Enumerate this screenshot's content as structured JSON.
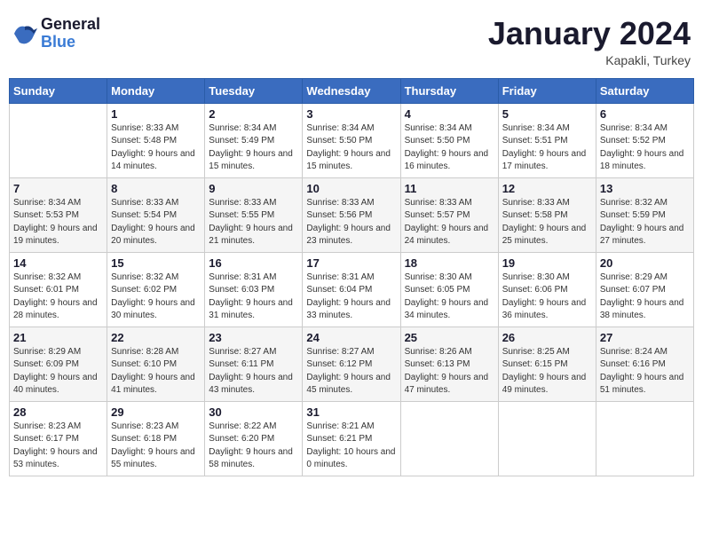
{
  "header": {
    "logo_line1": "General",
    "logo_line2": "Blue",
    "month": "January 2024",
    "location": "Kapakli, Turkey"
  },
  "weekdays": [
    "Sunday",
    "Monday",
    "Tuesday",
    "Wednesday",
    "Thursday",
    "Friday",
    "Saturday"
  ],
  "weeks": [
    [
      {
        "day": "",
        "sunrise": "",
        "sunset": "",
        "daylight": ""
      },
      {
        "day": "1",
        "sunrise": "Sunrise: 8:33 AM",
        "sunset": "Sunset: 5:48 PM",
        "daylight": "Daylight: 9 hours and 14 minutes."
      },
      {
        "day": "2",
        "sunrise": "Sunrise: 8:34 AM",
        "sunset": "Sunset: 5:49 PM",
        "daylight": "Daylight: 9 hours and 15 minutes."
      },
      {
        "day": "3",
        "sunrise": "Sunrise: 8:34 AM",
        "sunset": "Sunset: 5:50 PM",
        "daylight": "Daylight: 9 hours and 15 minutes."
      },
      {
        "day": "4",
        "sunrise": "Sunrise: 8:34 AM",
        "sunset": "Sunset: 5:50 PM",
        "daylight": "Daylight: 9 hours and 16 minutes."
      },
      {
        "day": "5",
        "sunrise": "Sunrise: 8:34 AM",
        "sunset": "Sunset: 5:51 PM",
        "daylight": "Daylight: 9 hours and 17 minutes."
      },
      {
        "day": "6",
        "sunrise": "Sunrise: 8:34 AM",
        "sunset": "Sunset: 5:52 PM",
        "daylight": "Daylight: 9 hours and 18 minutes."
      }
    ],
    [
      {
        "day": "7",
        "sunrise": "Sunrise: 8:34 AM",
        "sunset": "Sunset: 5:53 PM",
        "daylight": "Daylight: 9 hours and 19 minutes."
      },
      {
        "day": "8",
        "sunrise": "Sunrise: 8:33 AM",
        "sunset": "Sunset: 5:54 PM",
        "daylight": "Daylight: 9 hours and 20 minutes."
      },
      {
        "day": "9",
        "sunrise": "Sunrise: 8:33 AM",
        "sunset": "Sunset: 5:55 PM",
        "daylight": "Daylight: 9 hours and 21 minutes."
      },
      {
        "day": "10",
        "sunrise": "Sunrise: 8:33 AM",
        "sunset": "Sunset: 5:56 PM",
        "daylight": "Daylight: 9 hours and 23 minutes."
      },
      {
        "day": "11",
        "sunrise": "Sunrise: 8:33 AM",
        "sunset": "Sunset: 5:57 PM",
        "daylight": "Daylight: 9 hours and 24 minutes."
      },
      {
        "day": "12",
        "sunrise": "Sunrise: 8:33 AM",
        "sunset": "Sunset: 5:58 PM",
        "daylight": "Daylight: 9 hours and 25 minutes."
      },
      {
        "day": "13",
        "sunrise": "Sunrise: 8:32 AM",
        "sunset": "Sunset: 5:59 PM",
        "daylight": "Daylight: 9 hours and 27 minutes."
      }
    ],
    [
      {
        "day": "14",
        "sunrise": "Sunrise: 8:32 AM",
        "sunset": "Sunset: 6:01 PM",
        "daylight": "Daylight: 9 hours and 28 minutes."
      },
      {
        "day": "15",
        "sunrise": "Sunrise: 8:32 AM",
        "sunset": "Sunset: 6:02 PM",
        "daylight": "Daylight: 9 hours and 30 minutes."
      },
      {
        "day": "16",
        "sunrise": "Sunrise: 8:31 AM",
        "sunset": "Sunset: 6:03 PM",
        "daylight": "Daylight: 9 hours and 31 minutes."
      },
      {
        "day": "17",
        "sunrise": "Sunrise: 8:31 AM",
        "sunset": "Sunset: 6:04 PM",
        "daylight": "Daylight: 9 hours and 33 minutes."
      },
      {
        "day": "18",
        "sunrise": "Sunrise: 8:30 AM",
        "sunset": "Sunset: 6:05 PM",
        "daylight": "Daylight: 9 hours and 34 minutes."
      },
      {
        "day": "19",
        "sunrise": "Sunrise: 8:30 AM",
        "sunset": "Sunset: 6:06 PM",
        "daylight": "Daylight: 9 hours and 36 minutes."
      },
      {
        "day": "20",
        "sunrise": "Sunrise: 8:29 AM",
        "sunset": "Sunset: 6:07 PM",
        "daylight": "Daylight: 9 hours and 38 minutes."
      }
    ],
    [
      {
        "day": "21",
        "sunrise": "Sunrise: 8:29 AM",
        "sunset": "Sunset: 6:09 PM",
        "daylight": "Daylight: 9 hours and 40 minutes."
      },
      {
        "day": "22",
        "sunrise": "Sunrise: 8:28 AM",
        "sunset": "Sunset: 6:10 PM",
        "daylight": "Daylight: 9 hours and 41 minutes."
      },
      {
        "day": "23",
        "sunrise": "Sunrise: 8:27 AM",
        "sunset": "Sunset: 6:11 PM",
        "daylight": "Daylight: 9 hours and 43 minutes."
      },
      {
        "day": "24",
        "sunrise": "Sunrise: 8:27 AM",
        "sunset": "Sunset: 6:12 PM",
        "daylight": "Daylight: 9 hours and 45 minutes."
      },
      {
        "day": "25",
        "sunrise": "Sunrise: 8:26 AM",
        "sunset": "Sunset: 6:13 PM",
        "daylight": "Daylight: 9 hours and 47 minutes."
      },
      {
        "day": "26",
        "sunrise": "Sunrise: 8:25 AM",
        "sunset": "Sunset: 6:15 PM",
        "daylight": "Daylight: 9 hours and 49 minutes."
      },
      {
        "day": "27",
        "sunrise": "Sunrise: 8:24 AM",
        "sunset": "Sunset: 6:16 PM",
        "daylight": "Daylight: 9 hours and 51 minutes."
      }
    ],
    [
      {
        "day": "28",
        "sunrise": "Sunrise: 8:23 AM",
        "sunset": "Sunset: 6:17 PM",
        "daylight": "Daylight: 9 hours and 53 minutes."
      },
      {
        "day": "29",
        "sunrise": "Sunrise: 8:23 AM",
        "sunset": "Sunset: 6:18 PM",
        "daylight": "Daylight: 9 hours and 55 minutes."
      },
      {
        "day": "30",
        "sunrise": "Sunrise: 8:22 AM",
        "sunset": "Sunset: 6:20 PM",
        "daylight": "Daylight: 9 hours and 58 minutes."
      },
      {
        "day": "31",
        "sunrise": "Sunrise: 8:21 AM",
        "sunset": "Sunset: 6:21 PM",
        "daylight": "Daylight: 10 hours and 0 minutes."
      },
      {
        "day": "",
        "sunrise": "",
        "sunset": "",
        "daylight": ""
      },
      {
        "day": "",
        "sunrise": "",
        "sunset": "",
        "daylight": ""
      },
      {
        "day": "",
        "sunrise": "",
        "sunset": "",
        "daylight": ""
      }
    ]
  ]
}
